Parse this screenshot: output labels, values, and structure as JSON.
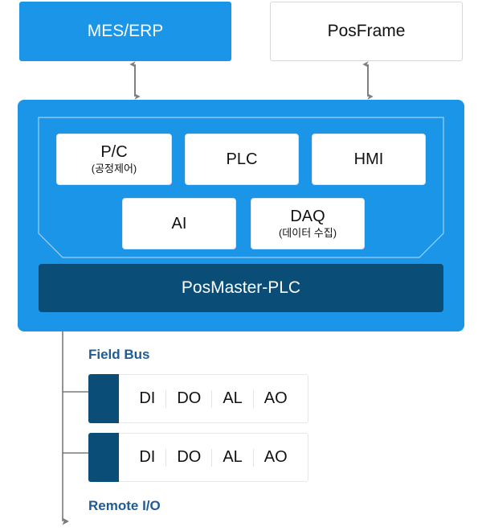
{
  "diagram": {
    "colors": {
      "bright_blue": "#1A95E8",
      "dark_blue": "#0A4E78",
      "label_blue": "#1F5C94",
      "arrow_gray": "#808080",
      "connector_gray": "#7a7a7a",
      "card_border": "#e2e2e2"
    },
    "top_row": [
      {
        "label": "MES/ERP",
        "style": "filled-blue"
      },
      {
        "label": "PosFrame",
        "style": "outlined-white"
      }
    ],
    "arrows": [
      {
        "name": "mes-erp-link",
        "direction": "bidirectional"
      },
      {
        "name": "posframe-link",
        "direction": "bidirectional"
      }
    ],
    "platform": {
      "modules_row1": [
        {
          "title": "P/C",
          "subtitle": "(공정제어)"
        },
        {
          "title": "PLC",
          "subtitle": ""
        },
        {
          "title": "HMI",
          "subtitle": ""
        }
      ],
      "modules_row2": [
        {
          "title": "AI",
          "subtitle": ""
        },
        {
          "title": "DAQ",
          "subtitle": "(데이터 수집)"
        }
      ],
      "controller": {
        "label": "PosMaster-PLC"
      }
    },
    "field": {
      "bus_label": "Field Bus",
      "remote_label": "Remote I/O",
      "io_modules": [
        {
          "cells": [
            "DI",
            "DO",
            "AL",
            "AO"
          ]
        },
        {
          "cells": [
            "DI",
            "DO",
            "AL",
            "AO"
          ]
        }
      ]
    }
  }
}
